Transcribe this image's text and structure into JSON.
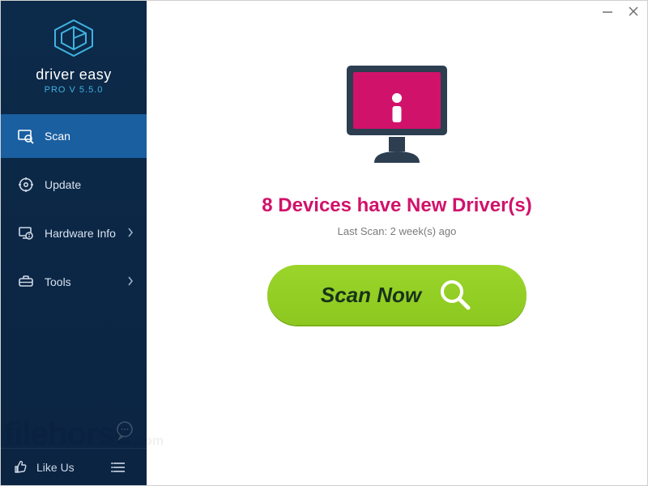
{
  "brand": {
    "name": "driver easy",
    "version_line": "PRO V 5.5.0"
  },
  "sidebar": {
    "items": [
      {
        "label": "Scan"
      },
      {
        "label": "Update"
      },
      {
        "label": "Hardware Info"
      },
      {
        "label": "Tools"
      }
    ]
  },
  "bottom": {
    "like_label": "Like Us"
  },
  "main": {
    "headline": "8 Devices have New Driver(s)",
    "last_scan": "Last Scan: 2 week(s) ago",
    "cta_label": "Scan Now"
  },
  "watermark": {
    "main": "filehorse",
    "suffix": ".com"
  },
  "colors": {
    "accent": "#1a5fa0",
    "headline": "#d1126b",
    "cta": "#8cc81f",
    "brand_blue": "#3fb3e0",
    "monitor": "#2c3e50",
    "monitor_screen": "#d1126b"
  }
}
